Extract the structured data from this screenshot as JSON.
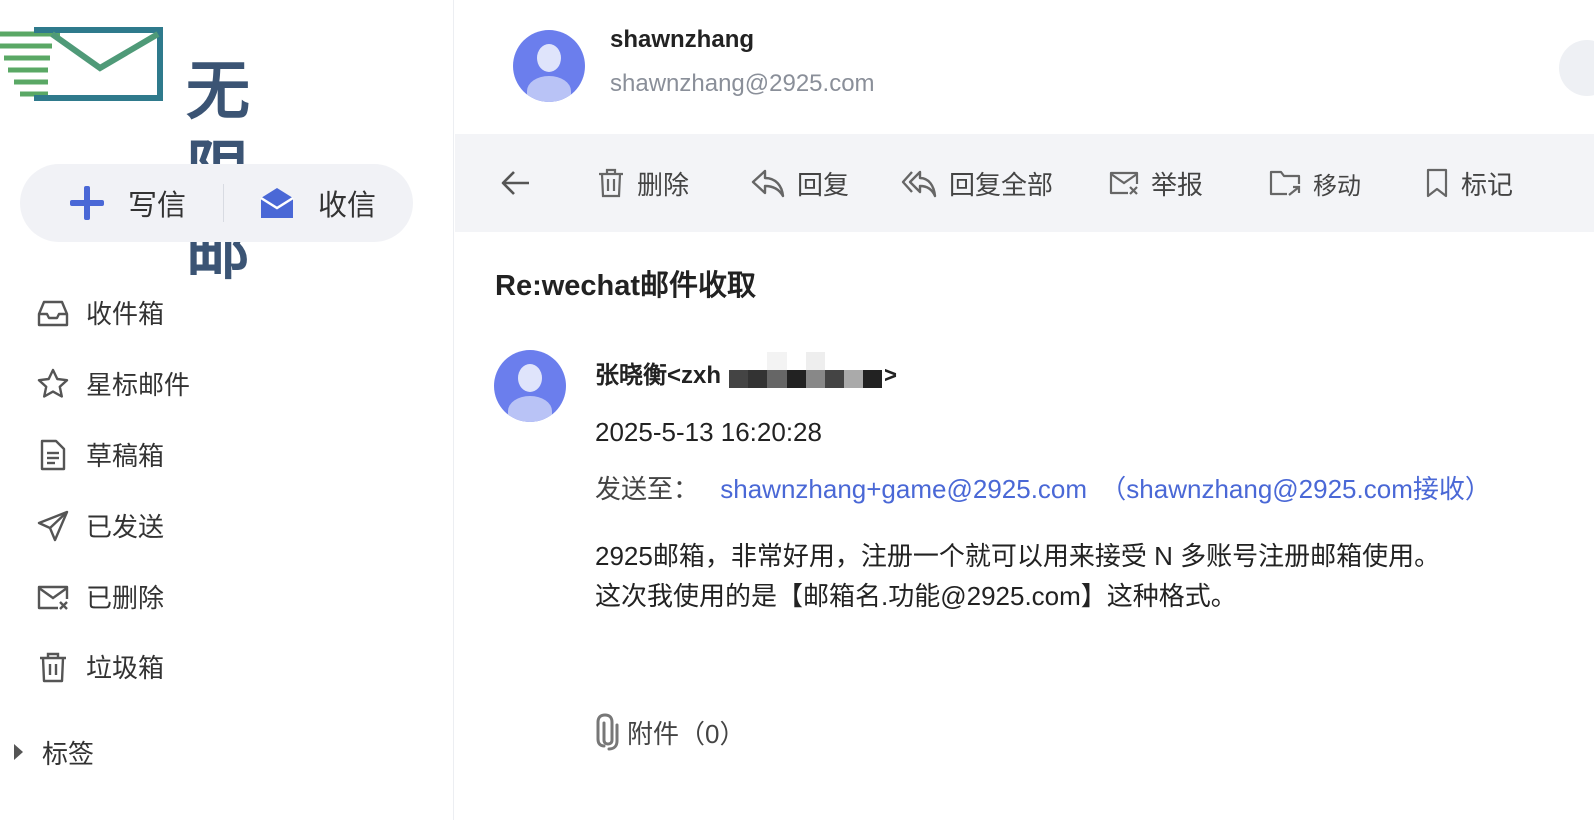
{
  "brand": {
    "name": "无限邮"
  },
  "compose": {
    "write_label": "写信",
    "receive_label": "收信"
  },
  "nav": {
    "items": [
      {
        "id": "inbox",
        "label": "收件箱",
        "icon": "inbox-icon"
      },
      {
        "id": "starred",
        "label": "星标邮件",
        "icon": "star-icon"
      },
      {
        "id": "drafts",
        "label": "草稿箱",
        "icon": "document-icon"
      },
      {
        "id": "sent",
        "label": "已发送",
        "icon": "paper-plane-icon"
      },
      {
        "id": "deleted",
        "label": "已删除",
        "icon": "mail-x-icon"
      },
      {
        "id": "trash",
        "label": "垃圾箱",
        "icon": "trash-icon"
      }
    ],
    "tags_label": "标签"
  },
  "user": {
    "name": "shawnzhang",
    "email": "shawnzhang@2925.com"
  },
  "toolbar": {
    "delete_label": "删除",
    "reply_label": "回复",
    "reply_all_label": "回复全部",
    "report_label": "举报",
    "move_label": "移动",
    "mark_label": "标记"
  },
  "message": {
    "subject": "Re:wechat邮件收取",
    "sender_prefix": "张晓衡<zxh",
    "sender_suffix": "om>",
    "date": "2025-5-13 16:20:28",
    "sendto_label": "发送至：",
    "sendto_address": "shawnzhang+game@2925.com",
    "sendto_receiver": "（shawnzhang@2925.com接收）",
    "body_line1": "2925邮箱，非常好用，注册一个就可以用来接受 N 多账号注册邮箱使用。",
    "body_line2": "这次我使用的是【邮箱名.功能@2925.com】这种格式。",
    "attachments_label": "附件（0）"
  },
  "colors": {
    "accent": "#4a68d6",
    "avatar": "#6b7eed",
    "toolbar_bg": "#f3f4f7",
    "compose_bg": "#f1f2f6",
    "logo_green": "#5aa865",
    "logo_teal": "#2f7a8c"
  }
}
